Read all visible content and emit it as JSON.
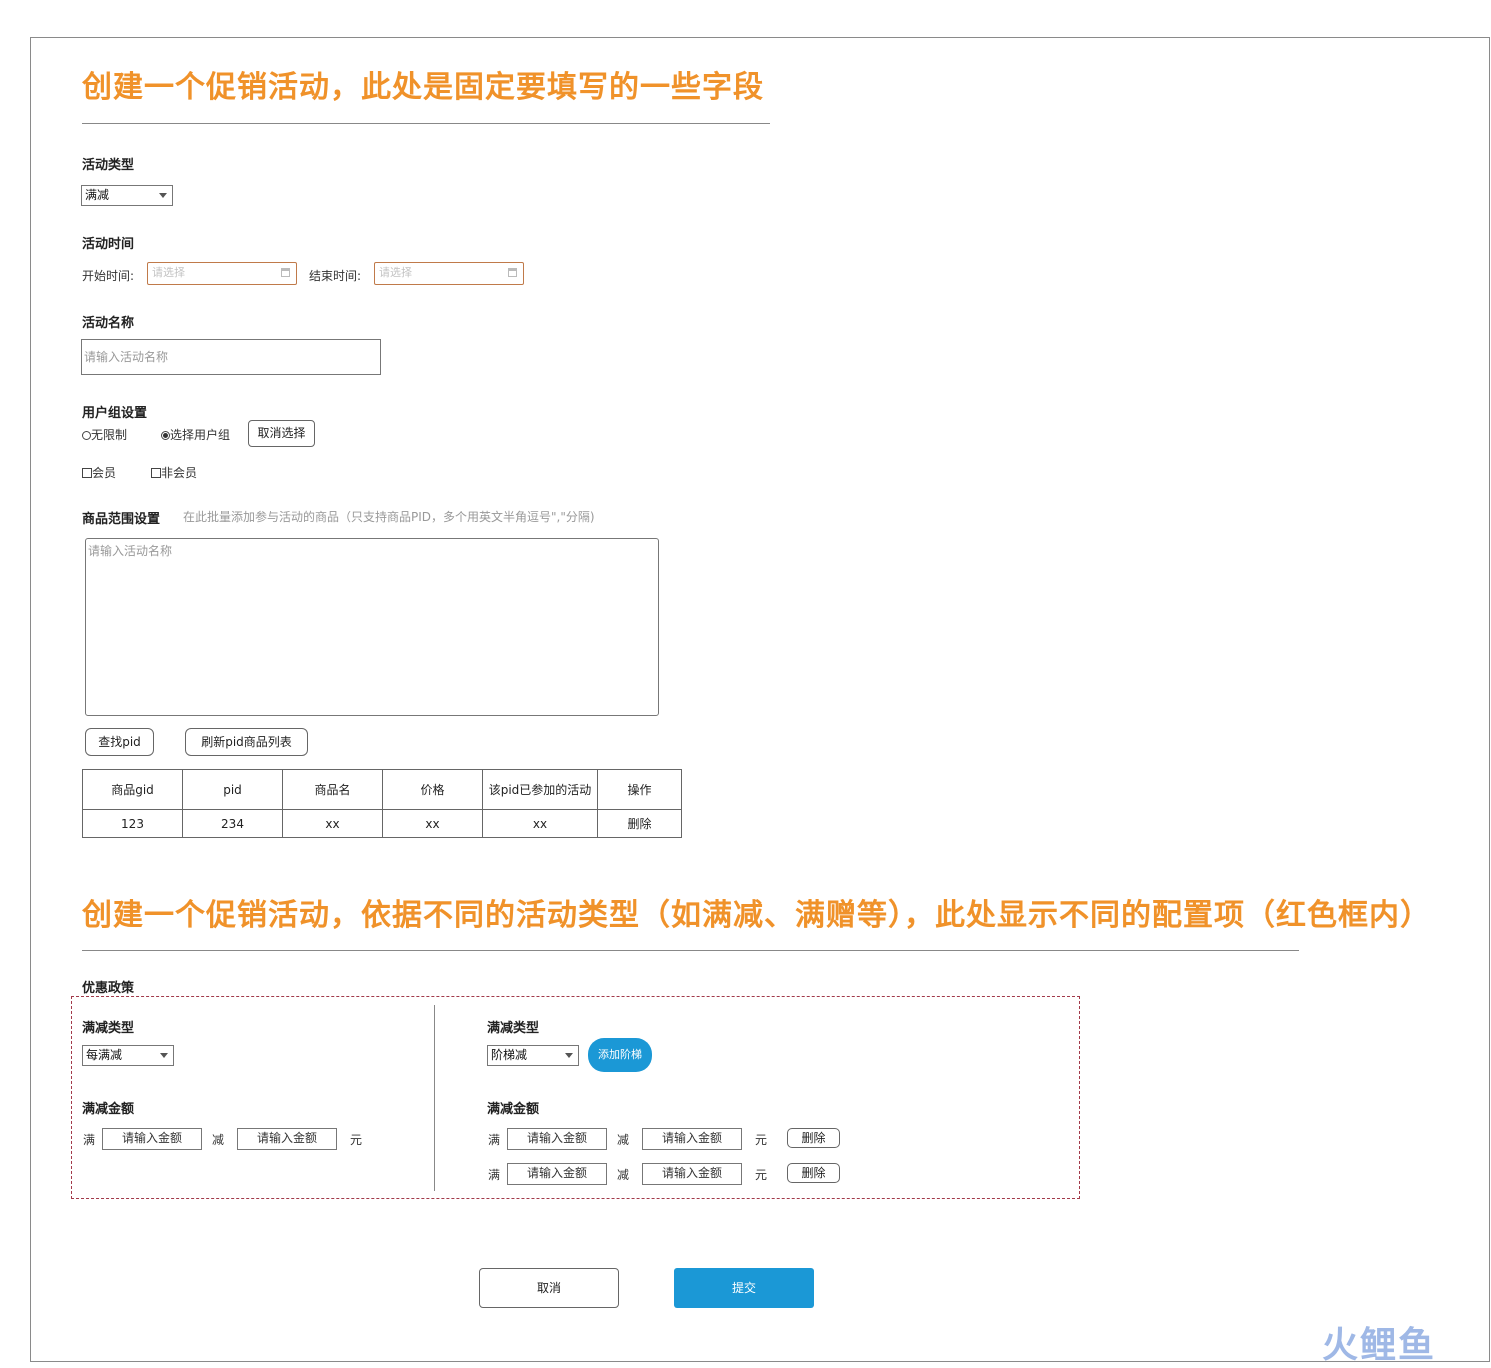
{
  "section1": {
    "heading": "创建一个促销活动，此处是固定要填写的一些字段",
    "activity_type": {
      "label": "活动类型",
      "selected": "满减"
    },
    "activity_time": {
      "label": "活动时间",
      "start_label": "开始时间:",
      "start_placeholder": "请选择",
      "end_label": "结束时间:",
      "end_placeholder": "请选择"
    },
    "activity_name": {
      "label": "活动名称",
      "placeholder": "请输入活动名称"
    },
    "user_group": {
      "label": "用户组设置",
      "radio_unlimited": "无限制",
      "radio_select": "选择用户组",
      "cancel_select": "取消选择",
      "checkbox_member": "会员",
      "checkbox_non_member": "非会员"
    },
    "goods_scope": {
      "label": "商品范围设置",
      "hint": "在此批量添加参与活动的商品（只支持商品PID，多个用英文半角逗号\",\"分隔)",
      "textarea_placeholder": "请输入活动名称",
      "find_pid": "查找pid",
      "refresh_list": "刷新pid商品列表"
    },
    "table": {
      "headers": [
        "商品gid",
        "pid",
        "商品名",
        "价格",
        "该pid已参加的活动",
        "操作"
      ],
      "rows": [
        [
          "123",
          "234",
          "xx",
          "xx",
          "xx",
          "删除"
        ]
      ]
    }
  },
  "section2": {
    "heading": "创建一个促销活动，依据不同的活动类型（如满减、满赠等），此处显示不同的配置项（红色框内）",
    "policy_label": "优惠政策",
    "left": {
      "type_label": "满减类型",
      "type_selected": "每满减",
      "amount_label": "满减金额",
      "man": "满",
      "jian": "减",
      "yuan": "元",
      "amount1_placeholder": "请输入金额",
      "amount2_placeholder": "请输入金额"
    },
    "right": {
      "type_label": "满减类型",
      "type_selected": "阶梯减",
      "add_tier": "添加阶梯",
      "amount_label": "满减金额",
      "rows": [
        {
          "man": "满",
          "a": "请输入金额",
          "jian": "减",
          "b": "请输入金额",
          "yuan": "元",
          "del": "删除"
        },
        {
          "man": "满",
          "a": "请输入金额",
          "jian": "减",
          "b": "请输入金额",
          "yuan": "元",
          "del": "删除"
        }
      ]
    }
  },
  "footer": {
    "cancel": "取消",
    "submit": "提交"
  },
  "watermark": "火鲤鱼",
  "colors": {
    "heading": "#f0922a",
    "primary": "#1b98d6",
    "dashed_border": "#a23a4a"
  }
}
